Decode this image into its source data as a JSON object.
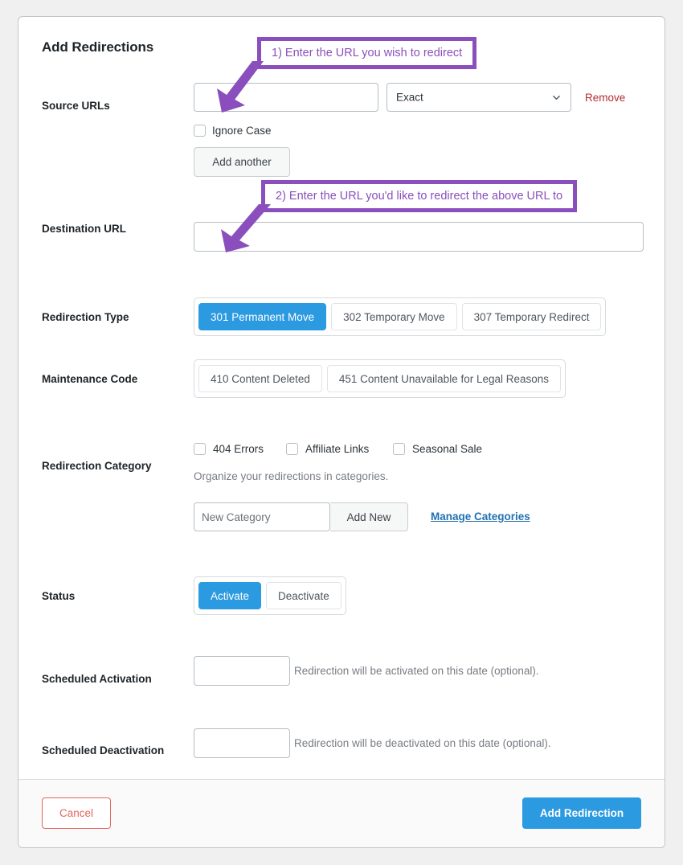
{
  "card": {
    "title": "Add Redirections"
  },
  "source": {
    "label": "Source URLs",
    "url_value": "",
    "url_placeholder": "",
    "match_selected": "Exact",
    "match_options": [
      "Exact"
    ],
    "remove_label": "Remove",
    "ignore_case_label": "Ignore Case",
    "ignore_case_checked": false,
    "add_another_label": "Add another"
  },
  "destination": {
    "label": "Destination URL",
    "value": "",
    "placeholder": ""
  },
  "redirection_type": {
    "label": "Redirection Type",
    "options": [
      {
        "label": "301 Permanent Move",
        "active": true
      },
      {
        "label": "302 Temporary Move",
        "active": false
      },
      {
        "label": "307 Temporary Redirect",
        "active": false
      }
    ]
  },
  "maintenance_code": {
    "label": "Maintenance Code",
    "options": [
      {
        "label": "410 Content Deleted",
        "active": false
      },
      {
        "label": "451 Content Unavailable for Legal Reasons",
        "active": false
      }
    ]
  },
  "category": {
    "label": "Redirection Category",
    "checkboxes": [
      {
        "label": "404 Errors",
        "checked": false
      },
      {
        "label": "Affiliate Links",
        "checked": false
      },
      {
        "label": "Seasonal Sale",
        "checked": false
      }
    ],
    "helper": "Organize your redirections in categories.",
    "new_category_value": "",
    "new_category_placeholder": "New Category",
    "add_new_label": "Add New",
    "manage_label": "Manage Categories"
  },
  "status": {
    "label": "Status",
    "options": [
      {
        "label": "Activate",
        "active": true
      },
      {
        "label": "Deactivate",
        "active": false
      }
    ]
  },
  "scheduled_activation": {
    "label": "Scheduled Activation",
    "value": "",
    "placeholder": "",
    "helper": "Redirection will be activated on this date (optional)."
  },
  "scheduled_deactivation": {
    "label": "Scheduled Deactivation",
    "value": "",
    "placeholder": "",
    "helper": "Redirection will be deactivated on this date (optional)."
  },
  "footer": {
    "cancel_label": "Cancel",
    "submit_label": "Add Redirection"
  },
  "annotations": [
    {
      "text": "1) Enter the URL you wish to redirect"
    },
    {
      "text": "2) Enter the URL you'd like to redirect the above URL to"
    }
  ],
  "colors": {
    "accent_blue": "#2b9ae0",
    "annotation_purple": "#8a4fbd",
    "link_blue": "#2271b1",
    "danger_red": "#b32d2e",
    "cancel_red": "#e2675f",
    "page_bg": "#f0f0f1"
  }
}
